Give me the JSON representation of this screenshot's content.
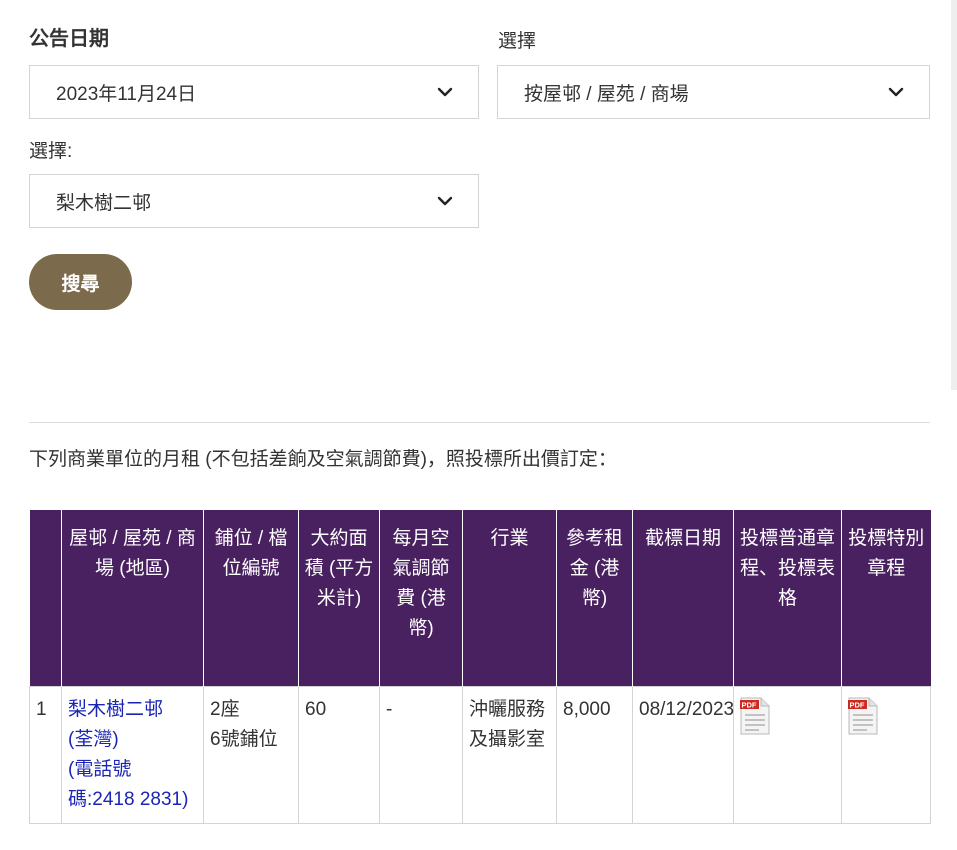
{
  "form": {
    "date_label": "公告日期",
    "date_value": "2023年11月24日",
    "type_label": "選擇",
    "type_value": "按屋邨 / 屋苑 / 商場",
    "estate_label": "選擇:",
    "estate_value": "梨木樹二邨",
    "search_label": "搜尋"
  },
  "intro_text": "下列商業單位的月租 (不包括差餉及空氣調節費)，照投標所出價訂定：",
  "table": {
    "headers": [
      "",
      "屋邨 / 屋苑 / 商場 (地區)",
      "鋪位 / 檔位編號",
      "大約面積 (平方米計)",
      "每月空氣調節費 (港幣)",
      "行業",
      "參考租金 (港幣)",
      "截標日期",
      "投標普通章程、投標表格",
      "投標特別章程"
    ],
    "rows": [
      {
        "index": "1",
        "estate_name": "梨木樹二邨",
        "district": "(荃灣)",
        "phone": "(電話號碼:2418 2831)",
        "unit_line1": "2座",
        "unit_line2": "6號鋪位",
        "area": "60",
        "aircon_fee": "-",
        "trade": "沖曬服務及攝影室",
        "ref_rent": "8,000",
        "closing_date": "08/12/2023",
        "general_doc_icon": "pdf-icon",
        "special_doc_icon": "pdf-icon"
      }
    ]
  },
  "colors": {
    "header_bg": "#4a2160",
    "button_bg": "#7b6a4c",
    "link": "#1b25b5"
  }
}
